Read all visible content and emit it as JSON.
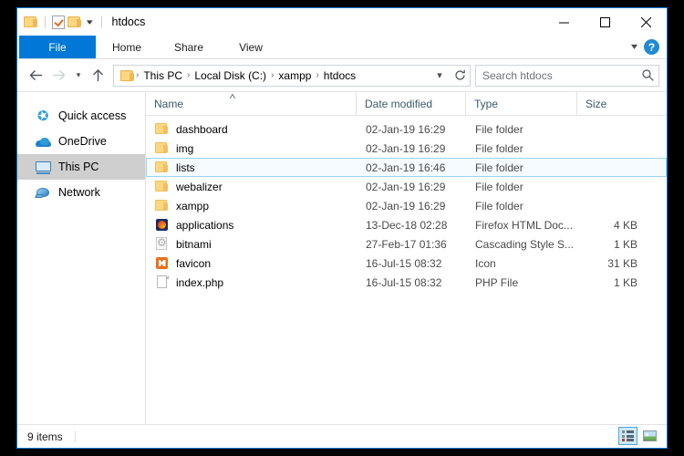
{
  "window": {
    "title": "htdocs",
    "quick_access_icons": [
      "folder-icon",
      "properties-icon",
      "new-folder-icon",
      "customize-caret-icon"
    ],
    "controls": {
      "minimize": "—",
      "maximize": "☐",
      "close": "✕"
    }
  },
  "ribbon": {
    "tabs": [
      {
        "label": "File",
        "active": true
      },
      {
        "label": "Home",
        "active": false
      },
      {
        "label": "Share",
        "active": false
      },
      {
        "label": "View",
        "active": false
      }
    ],
    "expand_caret": "⌄",
    "help_label": "?"
  },
  "address": {
    "back_glyph": "←",
    "forward_glyph": "→",
    "recent_glyph": "⌄",
    "up_glyph": "↑",
    "breadcrumbs": [
      "This PC",
      "Local Disk (C:)",
      "xampp",
      "htdocs"
    ],
    "separator": "›",
    "dropdown_glyph": "⌄",
    "refresh_glyph": "↻"
  },
  "search": {
    "placeholder": "Search htdocs",
    "icon": "search-icon"
  },
  "nav_pane": {
    "items": [
      {
        "label": "Quick access",
        "icon": "star-icon",
        "selected": false
      },
      {
        "label": "OneDrive",
        "icon": "cloud-icon",
        "selected": false
      },
      {
        "label": "This PC",
        "icon": "monitor-icon",
        "selected": true
      },
      {
        "label": "Network",
        "icon": "network-icon",
        "selected": false
      }
    ]
  },
  "file_list": {
    "columns": [
      {
        "label": "Name",
        "sorted": true,
        "sort_glyph": "˄"
      },
      {
        "label": "Date modified",
        "sorted": false
      },
      {
        "label": "Type",
        "sorted": false
      },
      {
        "label": "Size",
        "sorted": false
      }
    ],
    "rows": [
      {
        "name": "dashboard",
        "date": "02-Jan-19 16:29",
        "type": "File folder",
        "size": "",
        "icon": "folder-icon",
        "selected": false
      },
      {
        "name": "img",
        "date": "02-Jan-19 16:29",
        "type": "File folder",
        "size": "",
        "icon": "folder-icon",
        "selected": false
      },
      {
        "name": "lists",
        "date": "02-Jan-19 16:46",
        "type": "File folder",
        "size": "",
        "icon": "folder-icon",
        "selected": true
      },
      {
        "name": "webalizer",
        "date": "02-Jan-19 16:29",
        "type": "File folder",
        "size": "",
        "icon": "folder-icon",
        "selected": false
      },
      {
        "name": "xampp",
        "date": "02-Jan-19 16:29",
        "type": "File folder",
        "size": "",
        "icon": "folder-icon",
        "selected": false
      },
      {
        "name": "applications",
        "date": "13-Dec-18 02:28",
        "type": "Firefox HTML Doc...",
        "size": "4 KB",
        "icon": "firefox-icon",
        "selected": false
      },
      {
        "name": "bitnami",
        "date": "27-Feb-17 01:36",
        "type": "Cascading Style S...",
        "size": "1 KB",
        "icon": "css-icon",
        "selected": false
      },
      {
        "name": "favicon",
        "date": "16-Jul-15 08:32",
        "type": "Icon",
        "size": "31 KB",
        "icon": "xampp-icon",
        "selected": false
      },
      {
        "name": "index.php",
        "date": "16-Jul-15 08:32",
        "type": "PHP File",
        "size": "1 KB",
        "icon": "file-icon",
        "selected": false
      }
    ]
  },
  "status_bar": {
    "item_count": "9 items",
    "views": [
      {
        "name": "details-view",
        "active": true
      },
      {
        "name": "large-icons-view",
        "active": false
      }
    ]
  },
  "colors": {
    "accent": "#0078d7",
    "selection_fill": "#f5fbfe",
    "selection_border": "#9bd3f0",
    "nav_selected": "#cfcfcf",
    "folder": "#fcd77f"
  }
}
